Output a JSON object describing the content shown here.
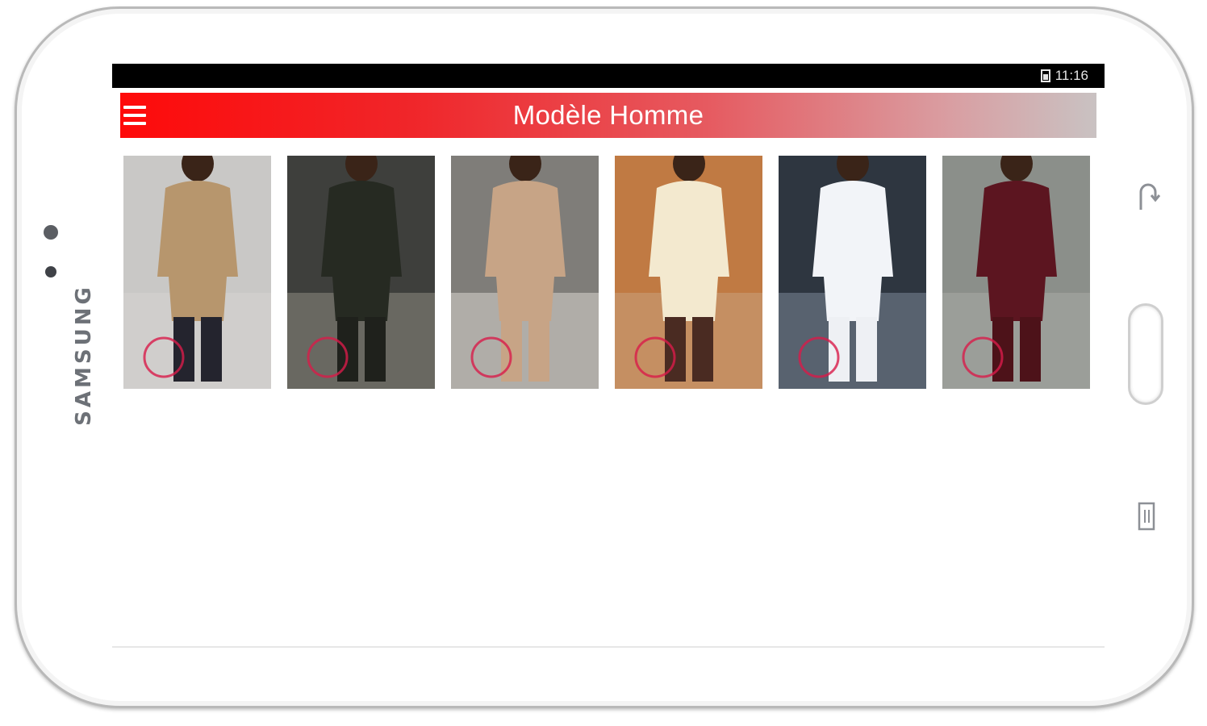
{
  "device": {
    "brand": "SAMSUNG"
  },
  "status_bar": {
    "time": "11:16",
    "battery_icon": "battery-icon"
  },
  "app_bar": {
    "title": "Modèle Homme",
    "menu_icon": "hamburger-menu-icon"
  },
  "gallery": {
    "items": [
      {
        "bg": "#c9c8c6",
        "top": "#b7966d",
        "bottom": "#24242e",
        "accent": "#d6d4d2"
      },
      {
        "bg": "#3e3f3c",
        "top": "#262a22",
        "bottom": "#1f211c",
        "accent": "#8d8a7f"
      },
      {
        "bg": "#7f7d79",
        "top": "#c7a486",
        "bottom": "#c7a486",
        "accent": "#d9d6d0"
      },
      {
        "bg": "#c07a43",
        "top": "#f3e9cf",
        "bottom": "#4a2b22",
        "accent": "#c8a07c"
      },
      {
        "bg": "#2e3640",
        "top": "#f2f4f8",
        "bottom": "#eef0f4",
        "accent": "#7b8796"
      },
      {
        "bg": "#8b8f8a",
        "top": "#5c1520",
        "bottom": "#4d1219",
        "accent": "#a9aca6"
      }
    ]
  }
}
